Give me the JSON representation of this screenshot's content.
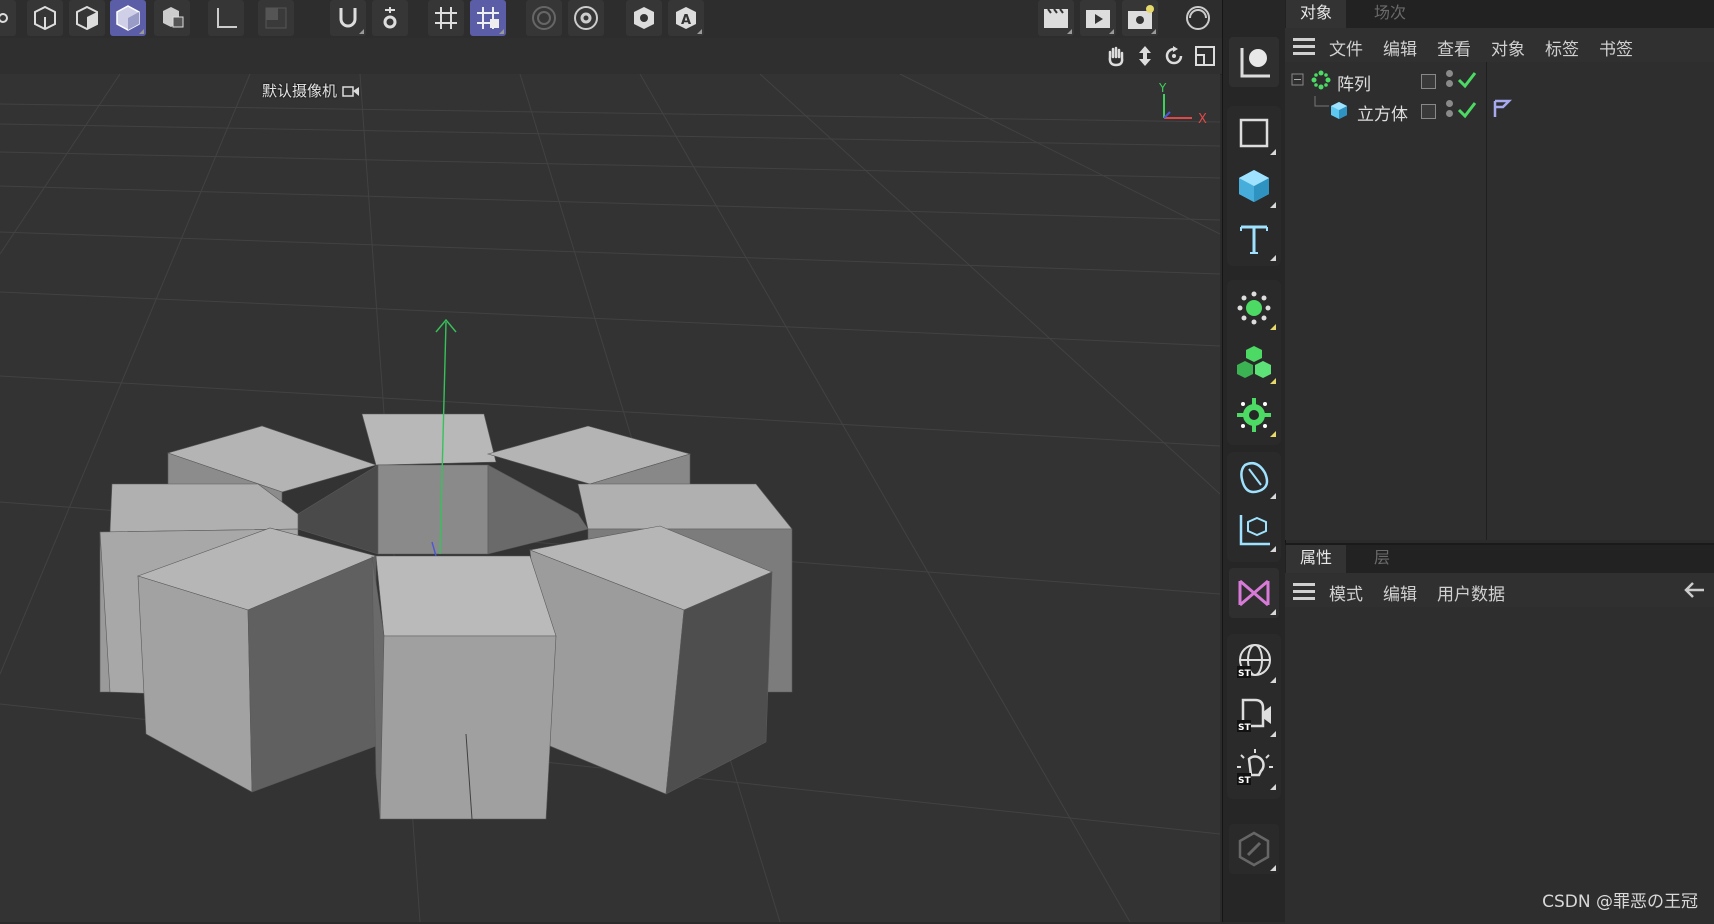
{
  "viewport": {
    "camera_label": "默认摄像机",
    "axis_y": "Y",
    "axis_x": "X"
  },
  "toolbar": {
    "icons": [
      "point-mode-icon",
      "edge-mode-icon",
      "polygon-mode-icon",
      "model-mode-icon",
      "texture-mode-icon",
      "axis-mode-icon",
      "solo-mode-icon",
      "snap-icon",
      "workplane-settings-icon",
      "grid-icon",
      "locked-workplane-icon",
      "soft-selection-icon",
      "modeling-settings-icon",
      "viewport-solo-icon",
      "auto-key-icon",
      "render-view-icon",
      "render-picture-viewer-icon",
      "render-settings-icon",
      "interactive-render-icon"
    ]
  },
  "palette": {
    "tools": [
      "move-tool-icon",
      "rectangle-spline-icon",
      "cube-icon",
      "text-icon",
      "array-icon",
      "cloner-icon",
      "gear-object-icon",
      "subdivision-icon",
      "null-axis-icon",
      "deformer-icon",
      "sky-icon",
      "camera-icon",
      "light-icon",
      "edit-icon"
    ]
  },
  "object_manager": {
    "tabs": [
      "对象",
      "场次"
    ],
    "menu": [
      "文件",
      "编辑",
      "查看",
      "对象",
      "标签",
      "书签"
    ],
    "objects": [
      {
        "name": "阵列"
      },
      {
        "name": "立方体"
      }
    ]
  },
  "attribute_manager": {
    "tabs": [
      "属性",
      "层"
    ],
    "menu": [
      "模式",
      "编辑",
      "用户数据"
    ]
  },
  "watermark": "CSDN @罪恶の王冠",
  "colors": {
    "accent": "#5b5ea6",
    "check_green": "#4cd964",
    "cube_blue": "#5ec8f0",
    "axis_y_green": "#3ecf5c",
    "axis_x_red": "#e04848"
  }
}
